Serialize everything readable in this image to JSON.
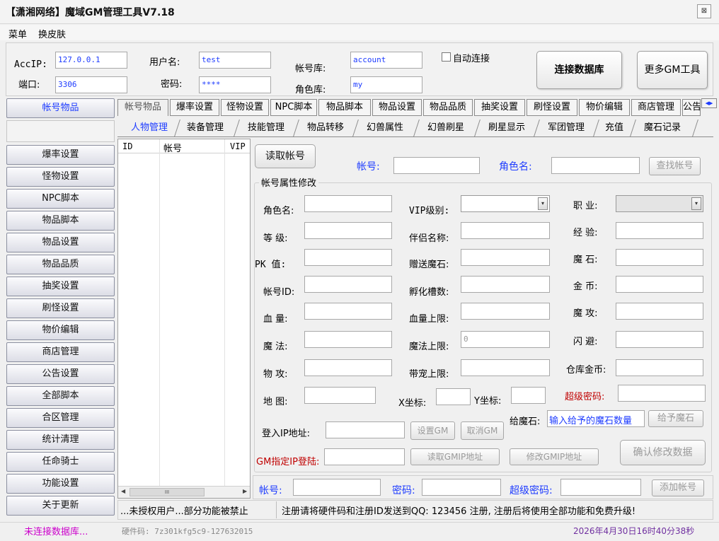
{
  "window": {
    "title": "【潇湘网络】魔域GM管理工具V7.18",
    "close": "⊠"
  },
  "menu": {
    "items": [
      "菜单",
      "换皮肤"
    ]
  },
  "conn": {
    "acc_ip_label": "AccIP:",
    "acc_ip": "127.0.0.1",
    "port_label": "端口:",
    "port": "3306",
    "user_label": "用户名:",
    "user": "test",
    "pass_label": "密码:",
    "pass": "****",
    "acctdb_label": "帐号库:",
    "acctdb": "account",
    "roledb_label": "角色库:",
    "roledb": "my",
    "auto_connect": "自动连接",
    "connect_btn": "连接数据库",
    "more_btn": "更多GM工具"
  },
  "sidebar": {
    "items": [
      "帐号物品",
      "",
      "爆率设置",
      "怪物设置",
      "NPC脚本",
      "物品脚本",
      "物品设置",
      "物品品质",
      "抽奖设置",
      "刷怪设置",
      "物价编辑",
      "商店管理",
      "公告设置",
      "全部脚本",
      "合区管理",
      "统计清理",
      "任命骑士",
      "功能设置",
      "关于更新"
    ]
  },
  "tabs": {
    "top": [
      "帐号物品",
      "爆率设置",
      "怪物设置",
      "NPC脚本",
      "物品脚本",
      "物品设置",
      "物品品质",
      "抽奖设置",
      "刷怪设置",
      "物价编辑",
      "商店管理",
      "公告"
    ],
    "sub": [
      "人物管理",
      "装备管理",
      "技能管理",
      "物品转移",
      "幻兽属性",
      "幻兽刷星",
      "刷星显示",
      "军团管理",
      "充值",
      "魔石记录"
    ],
    "scroll": "◀▶"
  },
  "list": {
    "headers": [
      "ID",
      "帐号",
      "VIP"
    ],
    "scroll_mid": "III",
    "left": "◀",
    "right": "▶"
  },
  "account": {
    "read_btn": "读取帐号",
    "acct_label": "帐号:",
    "role_label": "角色名:",
    "find_btn": "查找帐号",
    "group_title": "帐号属性修改",
    "f": {
      "rolename": "角色名:",
      "level": "等  级:",
      "pk": "PK  值:",
      "acctid": "帐号ID:",
      "hp": "血  量:",
      "mp": "魔  法:",
      "atk": "物  攻:",
      "map": "地  图:",
      "vip": "VIP级别:",
      "partner": "伴侣名称:",
      "gift_ms": "赠送魔石:",
      "hatch": "孵化槽数:",
      "hp_max": "血量上限:",
      "mp_max": "魔法上限:",
      "pet_max": "带宠上限:",
      "job": "职  业:",
      "exp": "经  验:",
      "magicstone": "魔  石:",
      "gold": "金  币:",
      "matk": "魔  攻:",
      "dodge": "闪  避:",
      "warehouse": "仓库金币:",
      "x": "X坐标:",
      "y": "Y坐标:",
      "super_pwd": "超级密码:",
      "give_ms": "给魔石:"
    },
    "mp_max_value": "0",
    "give_placeholder": "输入给予的魔石数量",
    "give_btn": "给予魔石",
    "login_ip": "登入IP地址:",
    "set_gm": "设置GM",
    "cancel_gm": "取消GM",
    "gm_login": "GM指定IP登陆:",
    "read_gm_ip": "读取GMIP地址",
    "mod_gm_ip": "修改GMIP地址",
    "confirm": "确认修改数据",
    "b_acct": "帐号:",
    "b_pwd": "密码:",
    "b_super": "超级密码:",
    "add_btn": "添加帐号"
  },
  "status": {
    "left": "...未授权用户...部分功能被禁止",
    "middle": "注册请将硬件码和注册ID发送到QQ: 123456 注册, 注册后将使用全部功能和免费升级!",
    "db": "未连接数据库...",
    "hwid": "硬件码: 7z301kfg5c9-127632015",
    "datetime": "2026年4月30日16时40分38秒"
  },
  "colors": {
    "accent": "#1e3cff",
    "alert": "#c00000",
    "magenta": "#cc00cc",
    "purple": "#7030a0"
  }
}
